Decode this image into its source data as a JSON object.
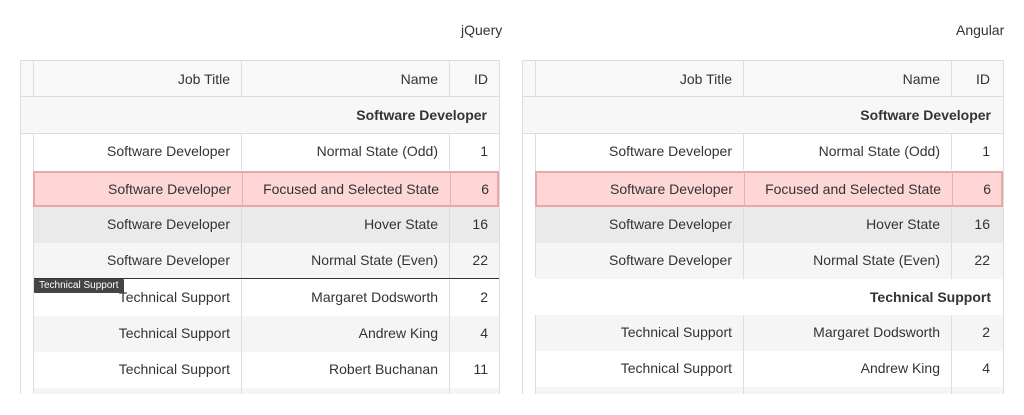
{
  "left_grid": {
    "title": "jQuery",
    "columns": {
      "job_title": "Job Title",
      "name": "Name",
      "id": "ID"
    },
    "group": "Software Developer",
    "rows": [
      {
        "job": "Software Developer",
        "name": "Normal State (Odd)",
        "id": "1"
      },
      {
        "job": "Software Developer",
        "name": "Focused and Selected State",
        "id": "6"
      },
      {
        "job": "Software Developer",
        "name": "Hover State",
        "id": "16"
      },
      {
        "job": "Software Developer",
        "name": "Normal State (Even)",
        "id": "22"
      },
      {
        "job": "Technical Support",
        "name": "Margaret Dodsworth",
        "id": "2"
      },
      {
        "job": "Technical Support",
        "name": "Andrew King",
        "id": "4"
      },
      {
        "job": "Technical Support",
        "name": "Robert Buchanan",
        "id": "11"
      }
    ],
    "tooltip": "Technical Support"
  },
  "right_grid": {
    "title": "Angular",
    "columns": {
      "job_title": "Job Title",
      "name": "Name",
      "id": "ID"
    },
    "group1": "Software Developer",
    "rows1": [
      {
        "job": "Software Developer",
        "name": "Normal State (Odd)",
        "id": "1"
      },
      {
        "job": "Software Developer",
        "name": "Focused and Selected State",
        "id": "6"
      },
      {
        "job": "Software Developer",
        "name": "Hover State",
        "id": "16"
      },
      {
        "job": "Software Developer",
        "name": "Normal State (Even)",
        "id": "22"
      }
    ],
    "group2": "Technical Support",
    "rows2": [
      {
        "job": "Technical Support",
        "name": "Margaret Dodsworth",
        "id": "2"
      },
      {
        "job": "Technical Support",
        "name": "Andrew King",
        "id": "4"
      }
    ]
  },
  "colors": {
    "selected_bg": "#ffd6d6",
    "selected_border": "#e8a8a8",
    "hover_bg": "#eaeaea",
    "header_bg": "#f8f8f8"
  }
}
